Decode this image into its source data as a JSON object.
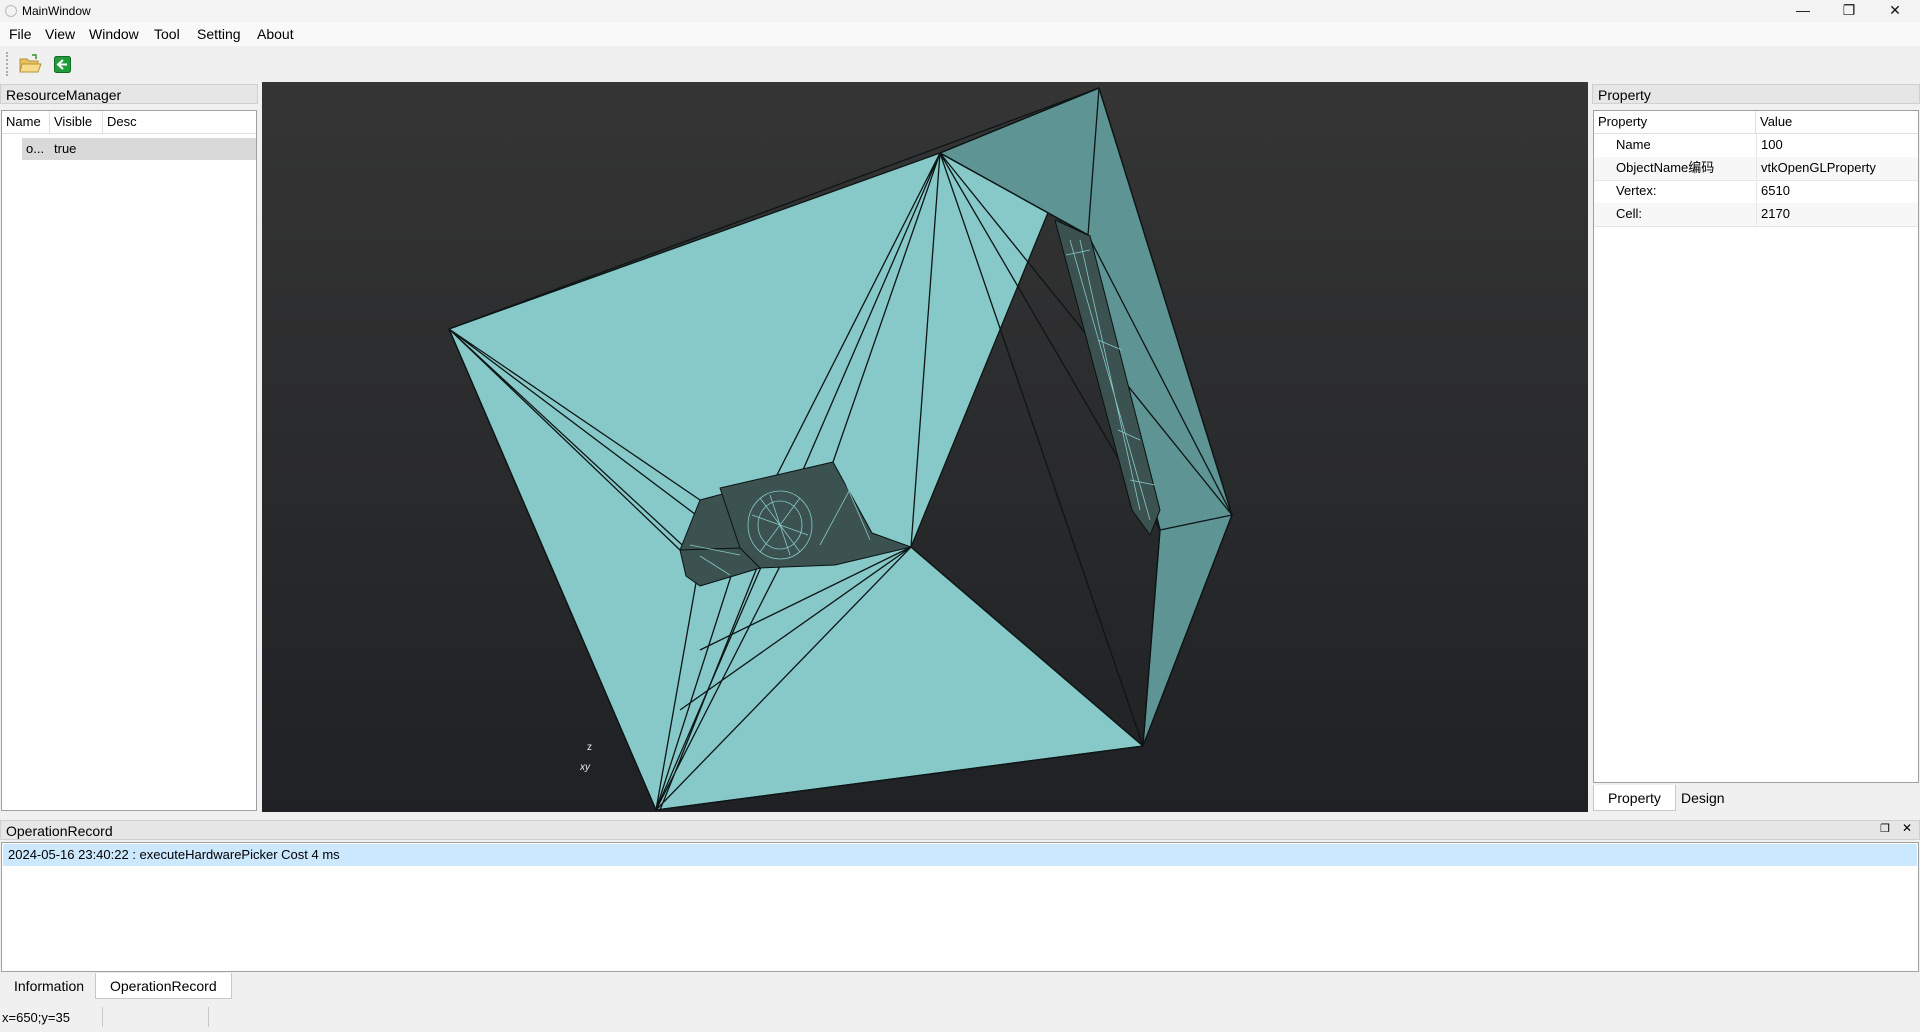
{
  "window": {
    "title": "MainWindow",
    "minimize": "—",
    "maximize": "❐",
    "close": "✕"
  },
  "menu": [
    "File",
    "View",
    "Window",
    "Tool",
    "Setting",
    "About"
  ],
  "toolbar": {
    "open_icon": "folder-open-icon",
    "back_icon": "arrow-back-icon"
  },
  "resource_manager": {
    "title": "ResourceManager",
    "columns": [
      "Name",
      "Visible",
      "Desc"
    ],
    "rows": [
      {
        "name": "o...",
        "visible": "true",
        "desc": ""
      }
    ]
  },
  "viewport": {
    "axis_labels": {
      "z": "z",
      "xy": "xy"
    },
    "colors": {
      "light_face": "#86c9c8",
      "dark_face": "#5e9493",
      "background_top": "#353535",
      "background_bottom": "#1f2124"
    }
  },
  "property": {
    "title": "Property",
    "columns": [
      "Property",
      "Value"
    ],
    "rows": [
      {
        "key": "Name",
        "value": "100"
      },
      {
        "key": "ObjectName编码",
        "value": "vtkOpenGLProperty"
      },
      {
        "key": "Vertex:",
        "value": "6510"
      },
      {
        "key": "Cell:",
        "value": "2170"
      }
    ],
    "tabs": [
      "Property",
      "Design"
    ]
  },
  "operation_record": {
    "title": "OperationRecord",
    "entries": [
      "2024-05-16 23:40:22 : executeHardwarePicker Cost  4  ms"
    ]
  },
  "bottom_tabs": [
    "Information",
    "OperationRecord"
  ],
  "status": {
    "coords": "x=650;y=35"
  }
}
